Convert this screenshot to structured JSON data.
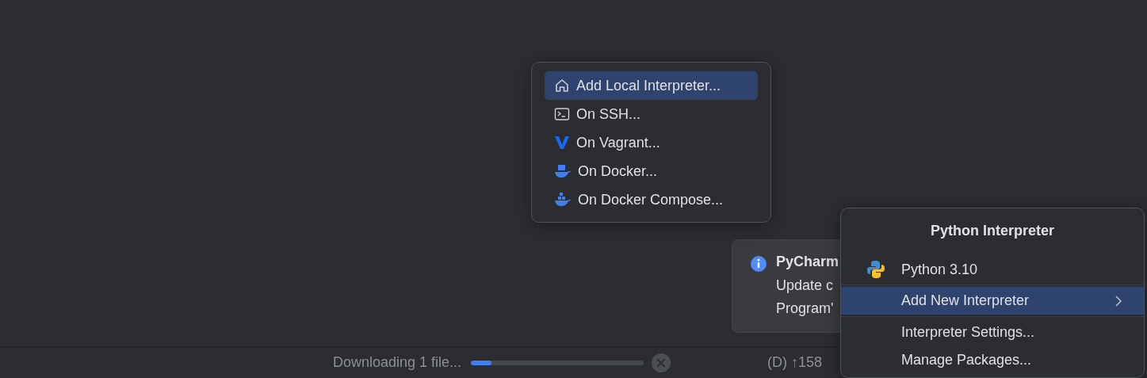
{
  "interpreter_submenu": {
    "items": [
      {
        "label": "Add Local Interpreter...",
        "kind": "home",
        "selected": true
      },
      {
        "label": "On SSH...",
        "kind": "terminal",
        "selected": false
      },
      {
        "label": "On Vagrant...",
        "kind": "vagrant",
        "selected": false
      },
      {
        "label": "On Docker...",
        "kind": "docker",
        "selected": false
      },
      {
        "label": "On Docker Compose...",
        "kind": "docker-compose",
        "selected": false
      }
    ]
  },
  "notification": {
    "title": "PyCharm",
    "lines": [
      "Update c",
      "Program'"
    ]
  },
  "interpreter_popup": {
    "title": "Python Interpreter",
    "groups": [
      [
        {
          "label": "Python 3.10",
          "kind": "interpreter",
          "selected": false
        }
      ],
      [
        {
          "label": "Add New Interpreter",
          "kind": "submenu",
          "selected": true
        }
      ],
      [
        {
          "label": "Interpreter Settings...",
          "kind": "action",
          "selected": false
        },
        {
          "label": "Manage Packages...",
          "kind": "action",
          "selected": false
        }
      ]
    ]
  },
  "status_bar": {
    "task": "Downloading 1 file...",
    "progress": {
      "level": 0.12
    },
    "info": "(D) ↑158"
  }
}
